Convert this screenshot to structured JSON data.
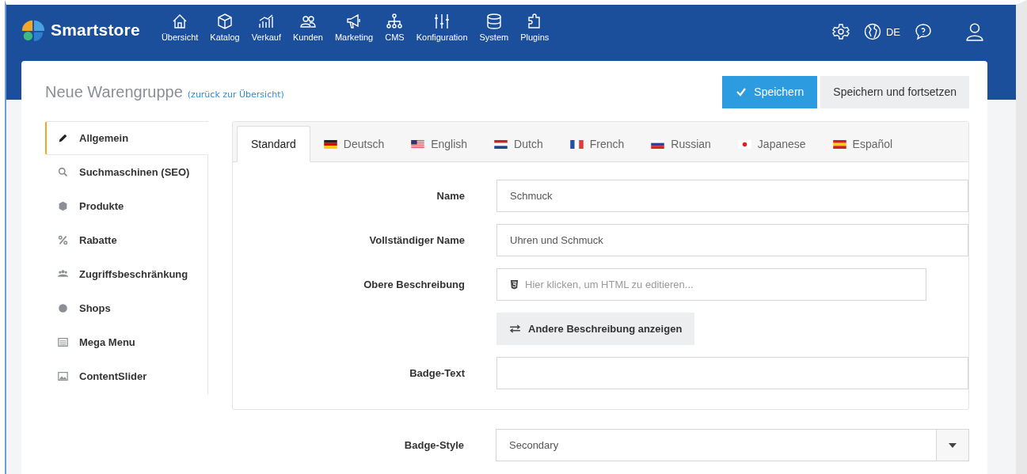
{
  "brand": {
    "name": "Smartstore"
  },
  "nav": [
    {
      "label": "Übersicht"
    },
    {
      "label": "Katalog"
    },
    {
      "label": "Verkauf"
    },
    {
      "label": "Kunden"
    },
    {
      "label": "Marketing"
    },
    {
      "label": "CMS"
    },
    {
      "label": "Konfiguration"
    },
    {
      "label": "System"
    },
    {
      "label": "Plugins"
    }
  ],
  "toolbar": {
    "language": "DE"
  },
  "page": {
    "title": "Neue Warengruppe",
    "back_link": "(zurück zur Übersicht)"
  },
  "actions": [
    {
      "label": "Speichern",
      "kind": "primary"
    },
    {
      "label": "Speichern und fortsetzen",
      "kind": "secondary"
    }
  ],
  "sidebar": {
    "items": [
      {
        "label": "Allgemein",
        "selected": true
      },
      {
        "label": "Suchmaschinen (SEO)",
        "selected": false
      },
      {
        "label": "Produkte",
        "selected": false
      },
      {
        "label": "Rabatte",
        "selected": false
      },
      {
        "label": "Zugriffsbeschränkung",
        "selected": false
      },
      {
        "label": "Shops",
        "selected": false
      },
      {
        "label": "Mega Menu",
        "selected": false
      },
      {
        "label": "ContentSlider",
        "selected": false
      }
    ]
  },
  "tabs": [
    {
      "label": "Standard",
      "selected": true
    },
    {
      "label": "Deutsch",
      "selected": false
    },
    {
      "label": "English",
      "selected": false
    },
    {
      "label": "Dutch",
      "selected": false
    },
    {
      "label": "French",
      "selected": false
    },
    {
      "label": "Russian",
      "selected": false
    },
    {
      "label": "Japanese",
      "selected": false
    },
    {
      "label": "Español",
      "selected": false
    }
  ],
  "form": [
    {
      "label": "Name",
      "kind": "text",
      "value": "Schmuck"
    },
    {
      "label": "Vollständiger Name",
      "kind": "text",
      "value": "Uhren und Schmuck"
    },
    {
      "label": "Obere Beschreibung",
      "kind": "html",
      "placeholder": "Hier klicken, um HTML zu editieren..."
    },
    {
      "kind": "button",
      "button": "Andere Beschreibung anzeigen"
    },
    {
      "label": "Badge-Text",
      "kind": "text"
    }
  ],
  "badge_style": {
    "label": "Badge-Style",
    "value": "Secondary"
  }
}
